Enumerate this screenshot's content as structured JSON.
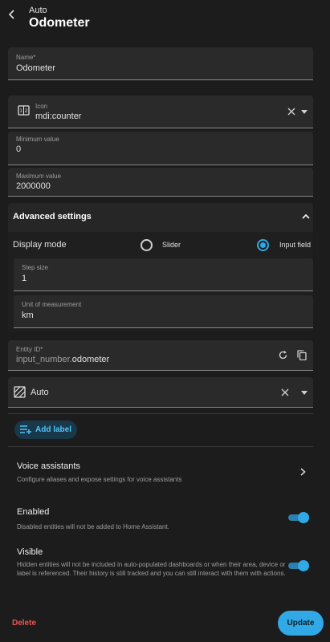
{
  "header": {
    "subtitle": "Auto",
    "title": "Odometer"
  },
  "name_field": {
    "label": "Name*",
    "value": "Odometer"
  },
  "icon_field": {
    "label": "Icon",
    "value": "mdi:counter"
  },
  "min_field": {
    "label": "Minimum value",
    "value": "0"
  },
  "max_field": {
    "label": "Maximum value",
    "value": "2000000"
  },
  "advanced": {
    "title": "Advanced settings",
    "display_mode_label": "Display mode",
    "options": [
      "Slider",
      "Input field"
    ],
    "selected": "Input field",
    "step": {
      "label": "Step size",
      "value": "1"
    },
    "unit": {
      "label": "Unit of measurement",
      "value": "km"
    }
  },
  "entity_id": {
    "label": "Entity ID*",
    "prefix": "input_number.",
    "value": "odometer"
  },
  "area": {
    "value": "Auto"
  },
  "add_label": "Add label",
  "voice": {
    "title": "Voice assistants",
    "description": "Configure aliases and expose settings for voice assistants"
  },
  "enabled": {
    "title": "Enabled",
    "description": "Disabled entities will not be added to Home Assistant.",
    "on": true
  },
  "visible": {
    "title": "Visible",
    "description": "Hidden entities will not be included in auto-populated dashboards or when their area, device or label is referenced. Their history is still tracked and you can still interact with them with actions.",
    "on": true
  },
  "footer": {
    "delete": "Delete",
    "update": "Update"
  },
  "colors": {
    "accent": "#30a9e6",
    "danger": "#ef5350",
    "background": "#1c1c1c"
  }
}
